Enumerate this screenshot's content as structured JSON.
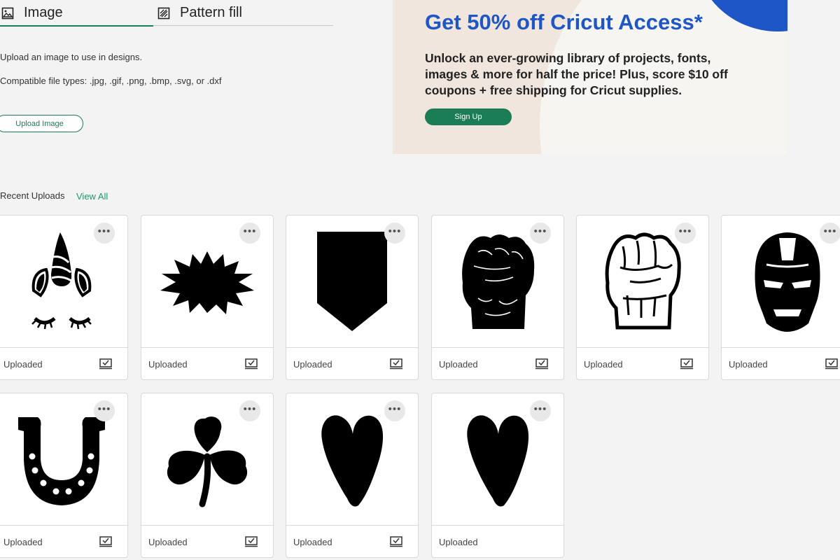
{
  "tabs": [
    {
      "label": "Image",
      "icon": "image-icon",
      "active": true
    },
    {
      "label": "Pattern fill",
      "icon": "pattern-fill-icon",
      "active": false
    }
  ],
  "upload": {
    "description": "Upload an image to use in designs.",
    "file_types": "Compatible file types: .jpg, .gif, .png, .bmp, .svg, or .dxf",
    "button_label": "Upload Image"
  },
  "promo": {
    "title": "Get 50% off Cricut Access*",
    "body": "Unlock an ever-growing library of projects, fonts, images & more for half the price! Plus, score $10 off coupons + free shipping for Cricut supplies.",
    "button_label": "Sign Up",
    "accent_color": "#1e56c8",
    "button_color": "#1b7d55"
  },
  "recent": {
    "label": "Recent Uploads",
    "view_all": "View All"
  },
  "uploads": [
    {
      "image": "unicorn-face-icon",
      "status": "Uploaded",
      "more": "•••"
    },
    {
      "image": "starburst-icon",
      "status": "Uploaded",
      "more": "•••"
    },
    {
      "image": "pennant-banner-icon",
      "status": "Uploaded",
      "more": "•••"
    },
    {
      "image": "hulk-fist-icon",
      "status": "Uploaded",
      "more": "•••"
    },
    {
      "image": "hulk-fist-outline-icon",
      "status": "Uploaded",
      "more": "•••"
    },
    {
      "image": "iron-man-helmet-icon",
      "status": "Uploaded",
      "more": "•••"
    },
    {
      "image": "horseshoe-icon",
      "status": "Uploaded",
      "more": "•••"
    },
    {
      "image": "shamrock-icon",
      "status": "Uploaded",
      "more": "•••"
    },
    {
      "image": "heart-icon",
      "status": "Uploaded",
      "more": "•••"
    },
    {
      "image": "heart-icon",
      "status": "Uploaded",
      "more": "•••"
    }
  ]
}
